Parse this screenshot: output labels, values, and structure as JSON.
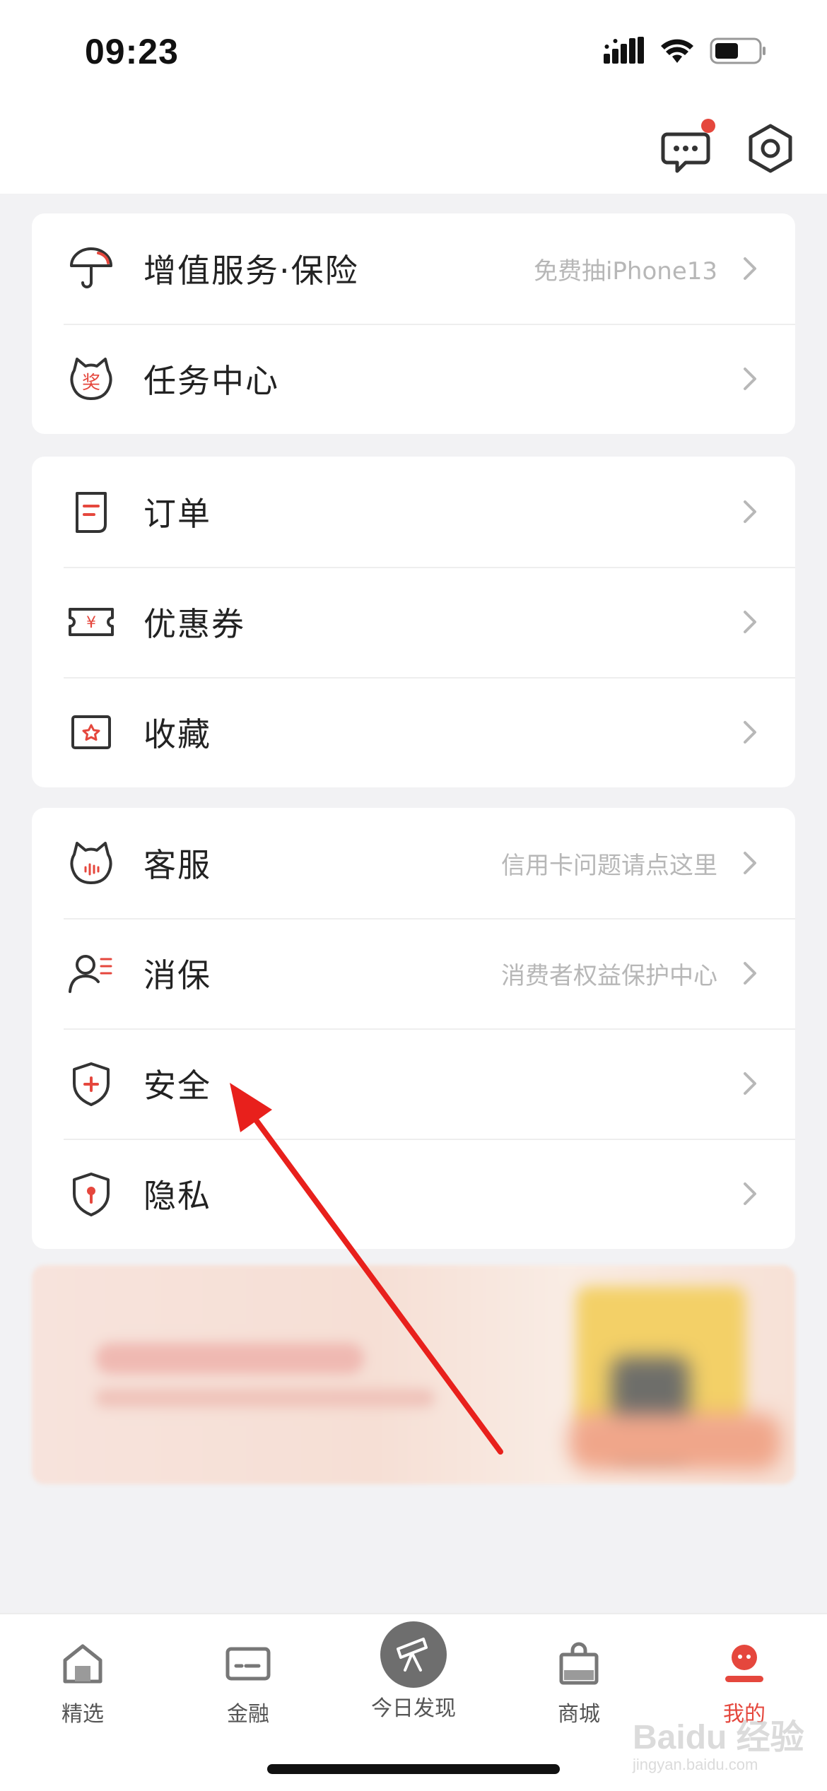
{
  "status_bar": {
    "time": "09:23"
  },
  "colors": {
    "accent": "#e5473d",
    "annotation_arrow": "#e8201c"
  },
  "header": {
    "icons": [
      "message-icon",
      "settings-gear-icon"
    ]
  },
  "groups": [
    {
      "items": [
        {
          "label": "增值服务·保险",
          "hint": "免费抽iPhone13",
          "icon": "umbrella-icon"
        },
        {
          "label": "任务中心",
          "hint": "",
          "icon": "reward-cat-icon"
        }
      ]
    },
    {
      "items": [
        {
          "label": "订单",
          "hint": "",
          "icon": "order-document-icon"
        },
        {
          "label": "优惠券",
          "hint": "",
          "icon": "coupon-icon"
        },
        {
          "label": "收藏",
          "hint": "",
          "icon": "favorite-star-icon"
        }
      ]
    },
    {
      "items": [
        {
          "label": "客服",
          "hint": "信用卡问题请点这里",
          "icon": "customer-service-icon"
        },
        {
          "label": "消保",
          "hint": "消费者权益保护中心",
          "icon": "consumer-protection-icon"
        },
        {
          "label": "安全",
          "hint": "",
          "icon": "security-shield-icon"
        },
        {
          "label": "隐私",
          "hint": "",
          "icon": "privacy-shield-icon"
        }
      ]
    }
  ],
  "tabbar": {
    "items": [
      {
        "label": "精选",
        "icon": "home-icon",
        "active": false
      },
      {
        "label": "金融",
        "icon": "card-icon",
        "active": false
      },
      {
        "label": "今日发现",
        "icon": "telescope-icon",
        "active": false
      },
      {
        "label": "商城",
        "icon": "shopping-bag-icon",
        "active": false
      },
      {
        "label": "我的",
        "icon": "profile-icon",
        "active": true
      }
    ]
  },
  "watermark": {
    "text": "Baidu 经验",
    "subtext": "jingyan.baidu.com"
  }
}
